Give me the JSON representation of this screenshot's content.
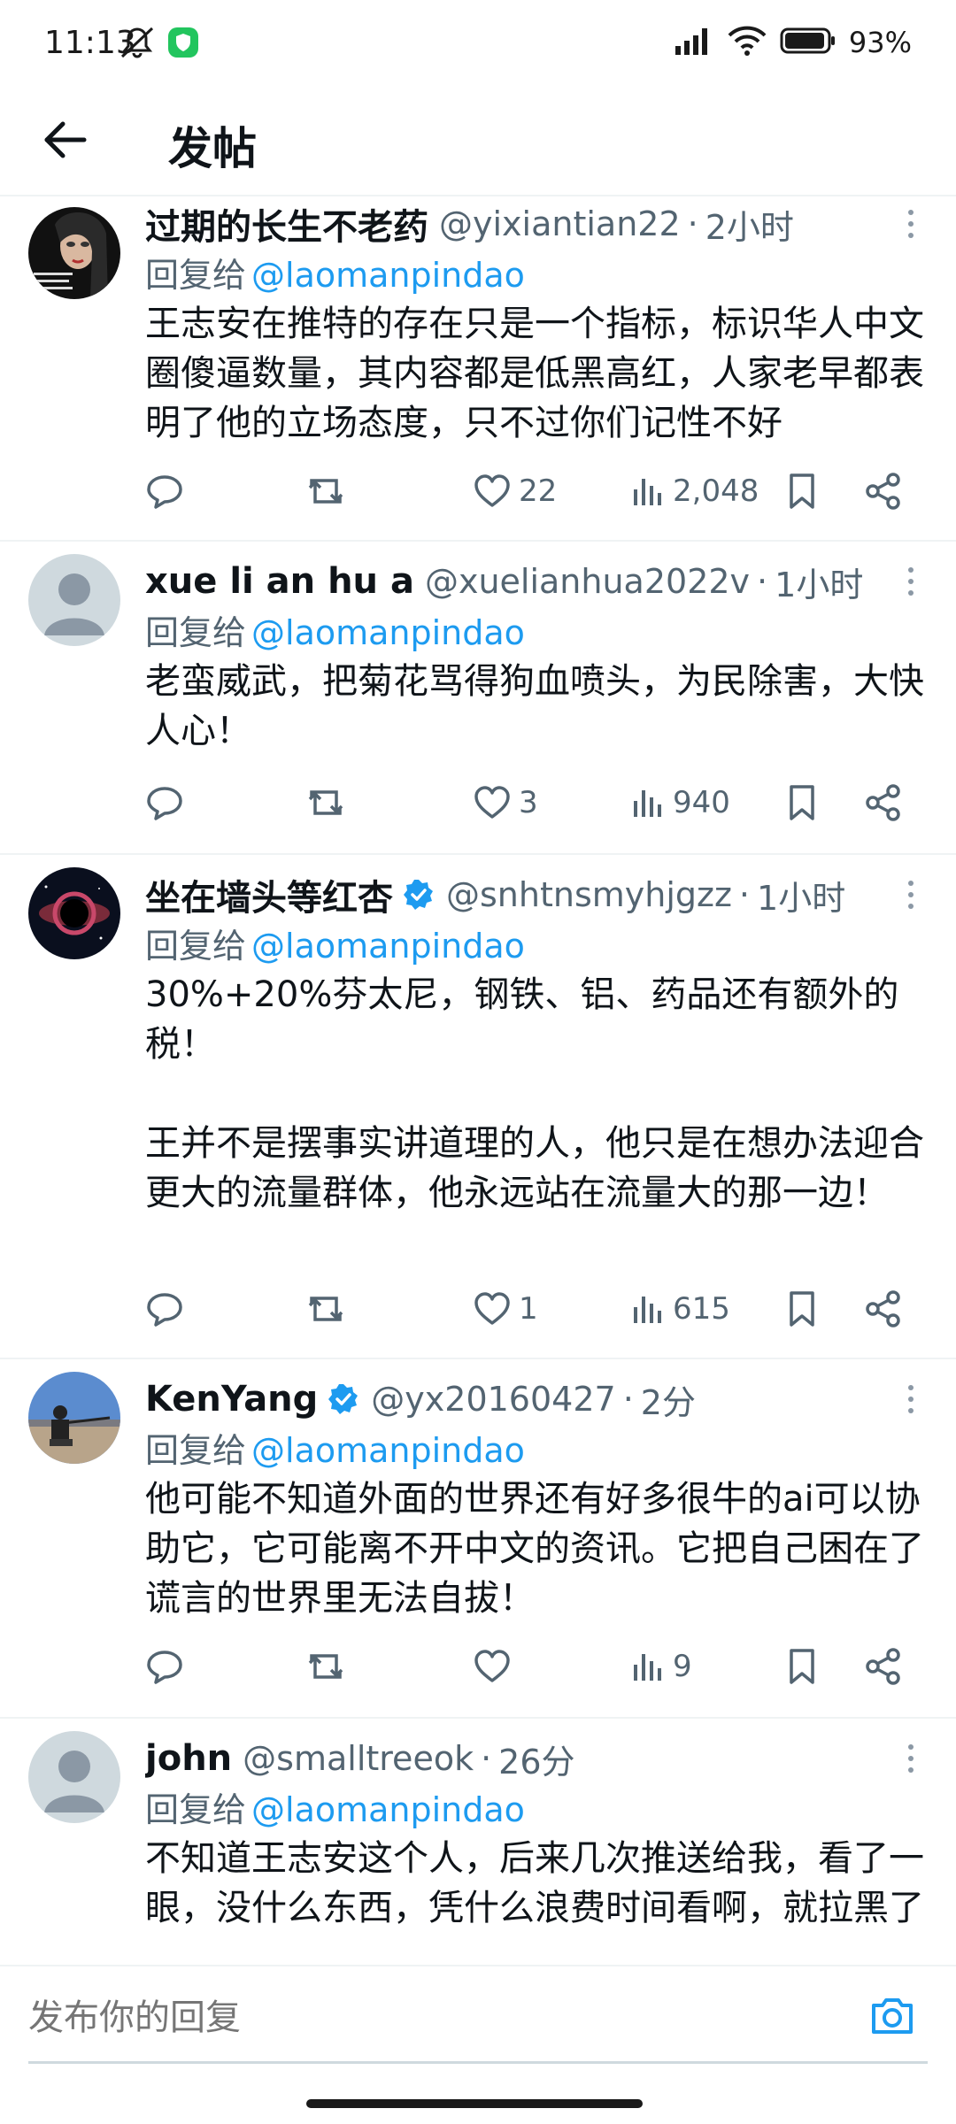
{
  "status_bar": {
    "time": "11:13",
    "battery": "93%",
    "icons": [
      "mute-icon",
      "app-shield-icon",
      "signal-icon",
      "wifi-icon",
      "battery-icon"
    ]
  },
  "header": {
    "title": "发帖",
    "back_icon": "arrow-left-icon"
  },
  "reply_prefix": "回复给",
  "tweets": [
    {
      "name": "过期的长生不老药",
      "verified": false,
      "handle": "@yixiantian22",
      "time": "2小时",
      "reply_to": "@laomanpindao",
      "text": "王志安在推特的存在只是一个指标，标识华人中文圈傻逼数量，其内容都是低黑高红，人家老早都表明了他的立场态度，只不过你们记性不好",
      "likes": "22",
      "views": "2,048"
    },
    {
      "name": "xue li an hu a",
      "verified": false,
      "handle": "@xuelianhua2022v",
      "time": "1小时",
      "reply_to": "@laomanpindao",
      "text": "老蛮威武，把菊花骂得狗血喷头，为民除害，大快人心！",
      "likes": "3",
      "views": "940"
    },
    {
      "name": "坐在墙头等红杏",
      "verified": true,
      "handle": "@snhtnsmyhjgzz",
      "time": "1小时",
      "reply_to": "@laomanpindao",
      "text": "30%+20%芬太尼，钢铁、铝、药品还有额外的税！\n\n王并不是摆事实讲道理的人，他只是在想办法迎合更大的流量群体，他永远站在流量大的那一边！",
      "likes": "1",
      "views": "615"
    },
    {
      "name": "KenYang",
      "verified": true,
      "handle": "@yx20160427",
      "time": "2分",
      "reply_to": "@laomanpindao",
      "text": "他可能不知道外面的世界还有好多很牛的ai可以协助它，它可能离不开中文的资讯。它把自己困在了谎言的世界里无法自拔！",
      "likes": "",
      "views": "9"
    },
    {
      "name": "john",
      "verified": false,
      "handle": "@smalltreeok",
      "time": "26分",
      "reply_to": "@laomanpindao",
      "text": "不知道王志安这个人，后来几次推送给我，看了一眼，没什么东西，凭什么浪费时间看啊，就拉黑了",
      "likes": "",
      "views": ""
    }
  ],
  "composer": {
    "placeholder": "发布你的回复",
    "camera_icon": "camera-icon"
  },
  "colors": {
    "accent": "#1d9bf0",
    "text": "#0f1419",
    "secondary": "#536471",
    "divider": "#eff3f4"
  }
}
